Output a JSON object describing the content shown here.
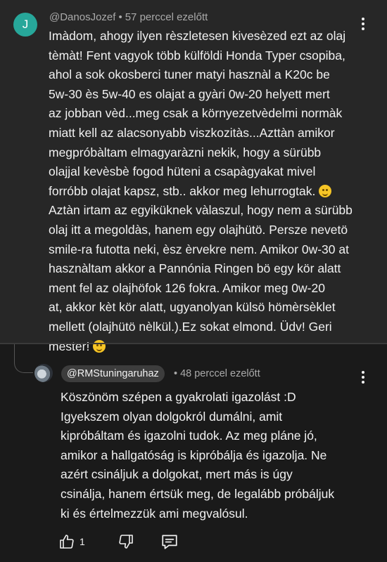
{
  "comment": {
    "avatar_letter": "J",
    "author": "@DanosJozef",
    "separator": "•",
    "time": "57 perccel ezelőtt",
    "text_part1": "Imàdom, ahogy ilyen rèszletesen kivesèzed ezt az olaj\ntèmàt! Fent vagyok több külföldi Honda Typer csopiba,\nahol a sok okosberci tuner matyi hasznàl a K20c be\n5w-30 ès 5w-40 es olajat a gyàri 0w-20 helyett mert\naz jobban vèd...meg csak a környezetvèdelmi normàk\nmiatt kell az alacsonyabb viszkozitàs...Azttàn amikor\nmegpróbàltam elmagyaràzni nekik, hogy a sürübb\nolajjal kevèsbè fogod hüteni a csapàgyakat mivel\nforróbb olajat kapsz, stb.. akkor meg lehurrogtak. ",
    "emoji1": "sweat-smile-emoji",
    "text_part2": "\nAztàn irtam az egyiküknek vàlaszul, hogy nem a sürübb\nolaj itt a megoldàs, hanem egy olajhütö. Persze nevetö\nsmile-ra futotta neki, èsz èrvekre nem. Amikor 0w-30 at\nhasznàltam akkor a Pannónia Ringen bö egy kör alatt\nment fel az olajhöfok 126 fokra. Amikor meg 0w-20\nat, akkor kèt kör alatt, ugyanolyan külsö hömèrsèklet\nmellett (olajhütö nèlkül.).Ez sokat elmond. Üdv! Geri\nmester! ",
    "emoji2": "smile-emoji",
    "avatar_color": "#27a79a"
  },
  "reply": {
    "author": "@RMStuningaruhaz",
    "separator": "•",
    "time": "48 perccel ezelőtt",
    "text": "Köszönöm szépen a gyakrolati igazolást :D\nIgyekszem olyan dolgokról dumálni, amit\nkipróbáltam és igazolni tudok. Az meg pláne jó,\namikor a hallgatóság is kipróbálja és igazolja. Ne\nazért csináljuk a dolgokat, mert más is úgy\ncsinálja, hanem értsük meg, de legalább próbáljuk\nki és értelmezzük ami megvalósul.",
    "like_count": "1",
    "icons": [
      "thumbs-up-icon",
      "thumbs-down-icon",
      "reply-icon",
      "more-icon"
    ]
  },
  "colors": {
    "background": "#1a1a1a",
    "comment_background": "#272727",
    "text": "#f1f1f1",
    "meta": "#aaaaaa"
  }
}
